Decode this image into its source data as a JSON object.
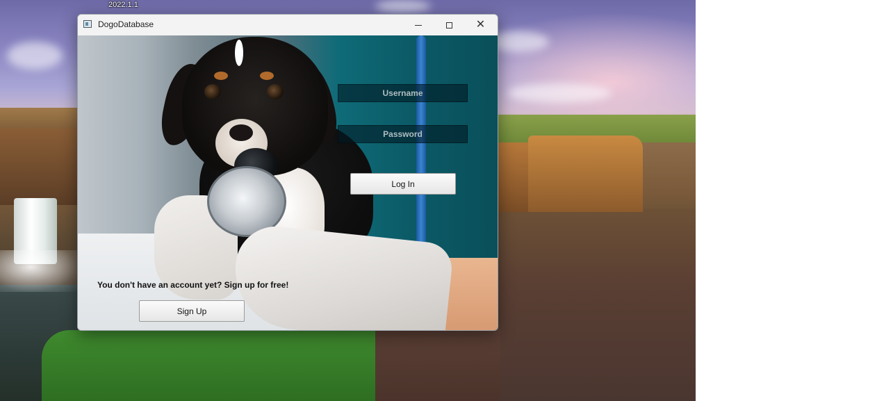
{
  "desktop": {
    "clock_text": "2022.1.1"
  },
  "window": {
    "title": "DogoDatabase",
    "icons": {
      "app": "window-app-icon",
      "minimize": "minimize-icon",
      "maximize": "maximize-icon",
      "close": "close-icon"
    }
  },
  "login_form": {
    "username_placeholder": "Username",
    "password_placeholder": "Password",
    "login_label": "Log In"
  },
  "signup": {
    "prompt": "You don't have an account yet? Sign up for free!",
    "button_label": "Sign Up"
  },
  "colors": {
    "scene_teal": "#0b5a66",
    "field_background": "#001923"
  }
}
